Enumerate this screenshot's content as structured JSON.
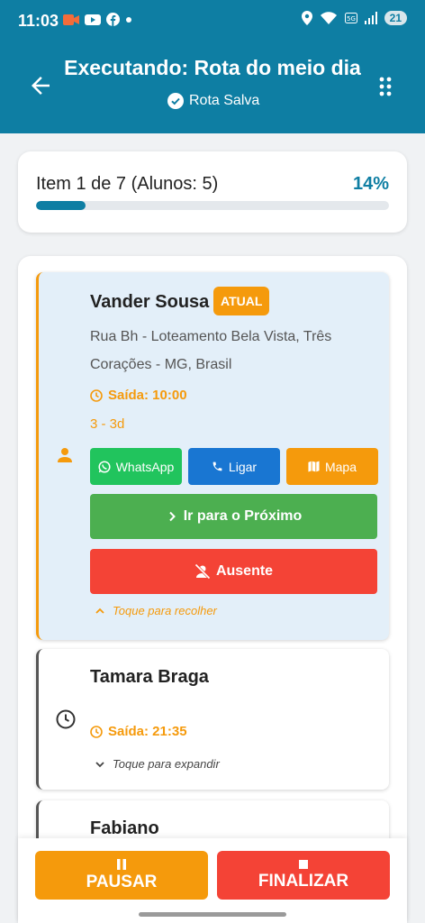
{
  "status_bar": {
    "time": "11:03",
    "battery": "21"
  },
  "header": {
    "title": "Executando: Rota do meio dia",
    "saved_label": "Rota Salva"
  },
  "progress": {
    "text": "Item 1 de 7 (Alunos: 5)",
    "percent_label": "14%",
    "percent": 14
  },
  "stops": [
    {
      "name": "Vander Sousa",
      "badge": "ATUAL",
      "address": "Rua Bh - Loteamento Bela Vista, Três Corações - MG, Brasil",
      "departure": "Saída: 10:00",
      "class": "3 - 3d",
      "whatsapp_label": "WhatsApp",
      "call_label": "Ligar",
      "map_label": "Mapa",
      "next_label": "Ir para o Próximo",
      "absent_label": "Ausente",
      "toggle_label": "Toque para recolher"
    },
    {
      "name": "Tamara Braga",
      "departure": "Saída: 21:35",
      "toggle_label": "Toque para expandir"
    },
    {
      "name": "Fabiano"
    }
  ],
  "actions": {
    "pause_label": "PAUSAR",
    "finish_label": "FINALIZAR"
  },
  "colors": {
    "primary": "#0e7ea3",
    "accent": "#f59a0c",
    "danger": "#f44336",
    "success": "#4caf50",
    "whatsapp": "#21c45d",
    "call": "#1976d2"
  }
}
